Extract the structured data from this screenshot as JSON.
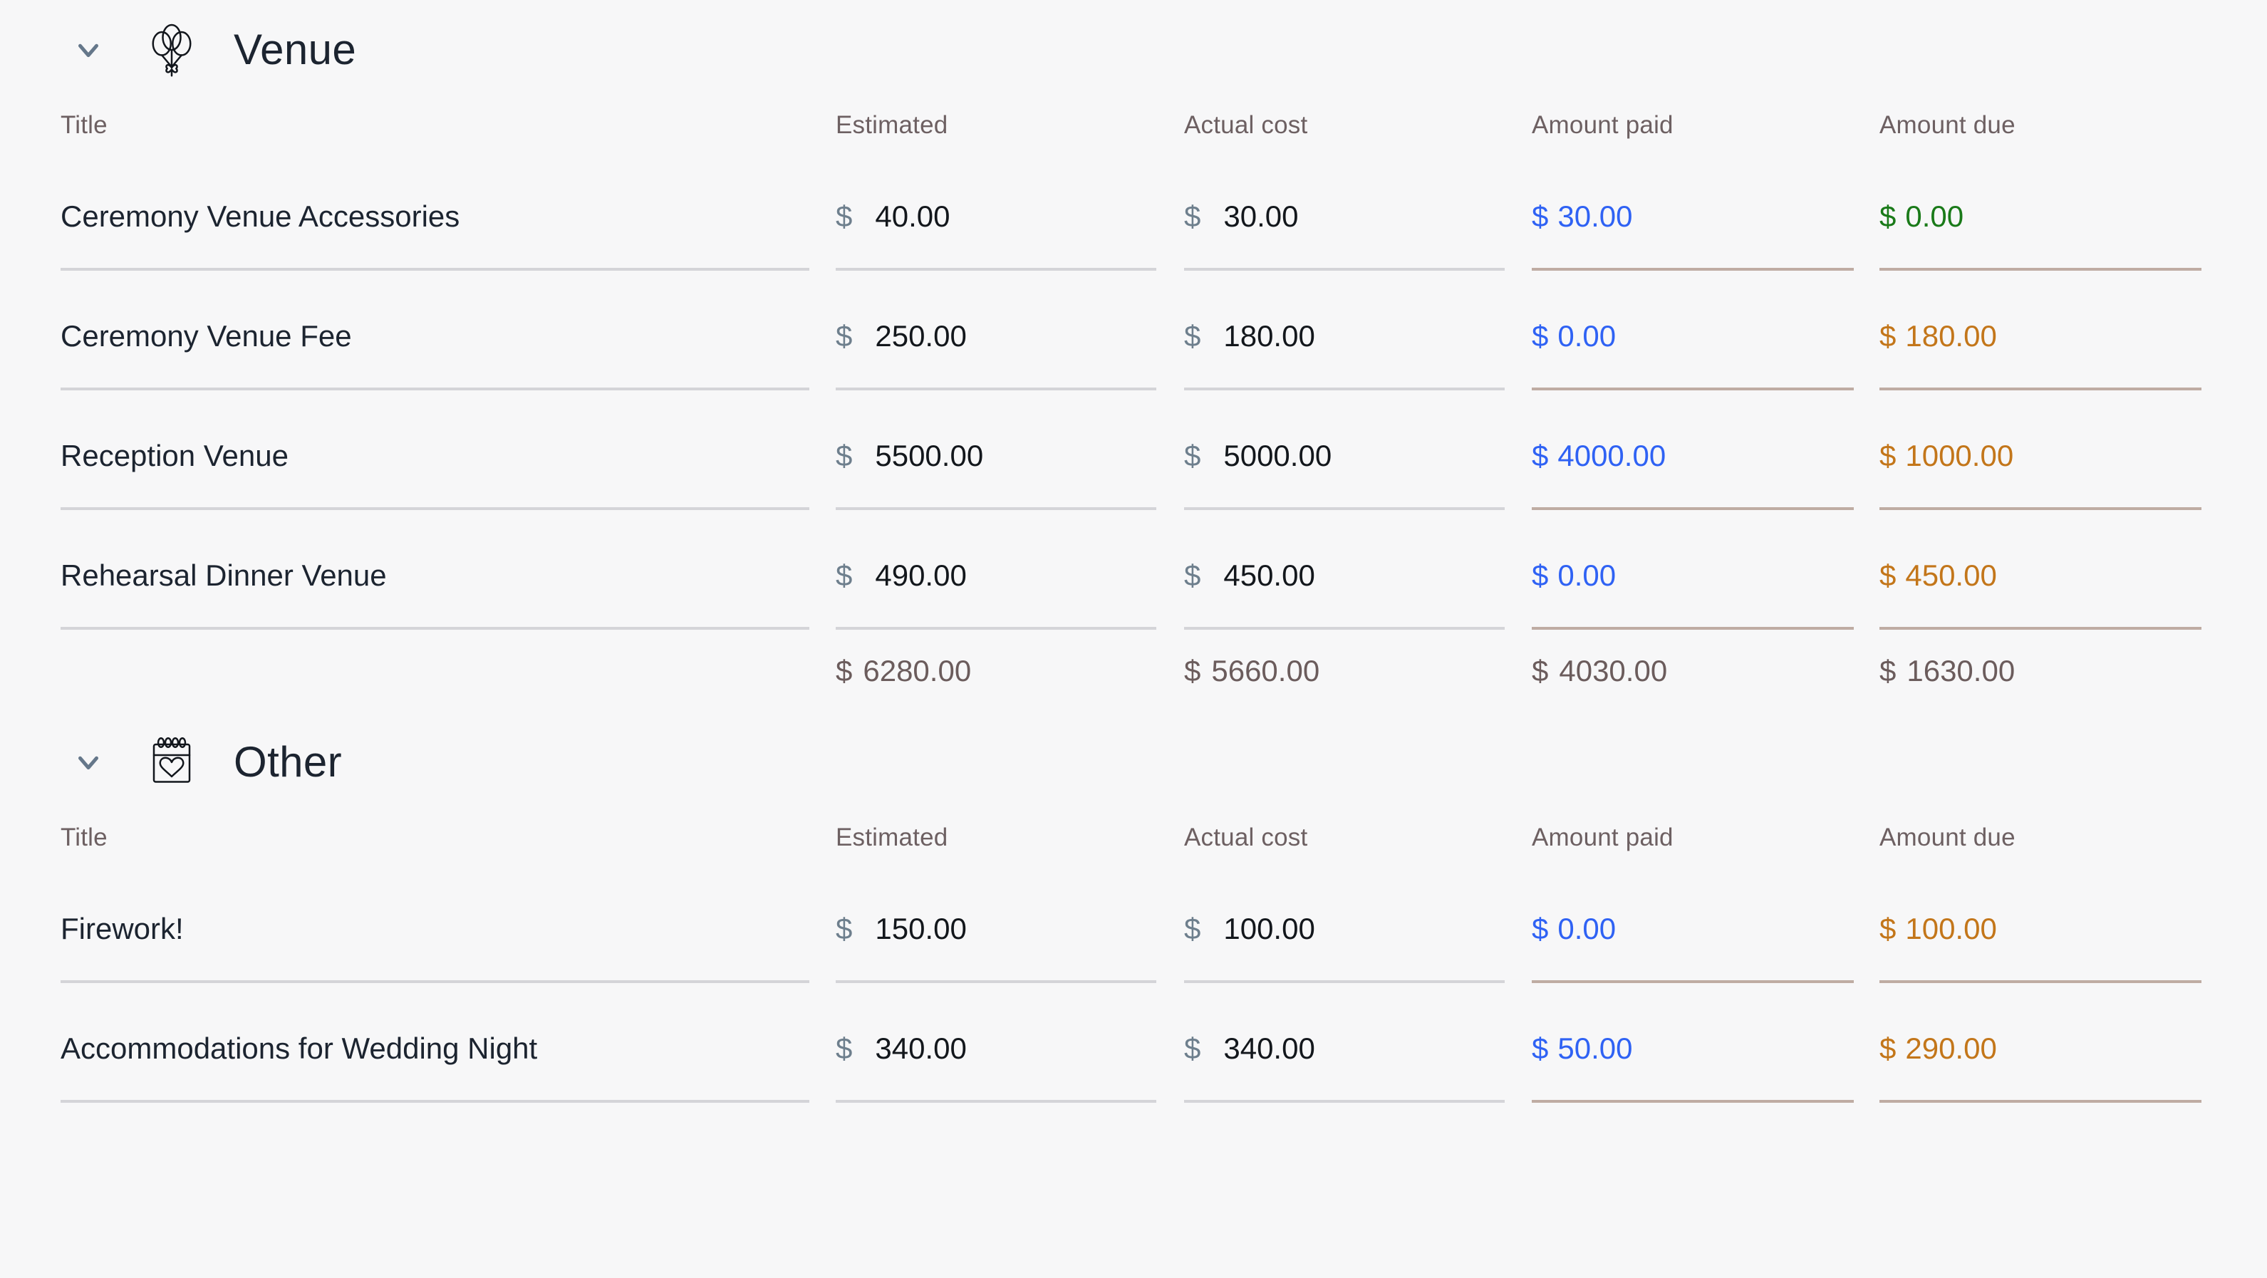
{
  "columns": {
    "title": "Title",
    "estimated": "Estimated",
    "actual": "Actual cost",
    "paid": "Amount paid",
    "due": "Amount due"
  },
  "currency_symbol": "$",
  "colors": {
    "paid": "#2f62f4",
    "due": "#c3761a",
    "due_zero": "#1a7a19",
    "total": "#6b5c5c",
    "symbol_muted": "#6e7f8d",
    "divider": "#d4d4d8",
    "divider_tan": "#bfaca3",
    "background": "#f7f7f8",
    "title_text": "#1c2430",
    "header_text": "#6d6062"
  },
  "sections": [
    {
      "id": "venue",
      "title": "Venue",
      "icon": "balloons-icon",
      "expanded": true,
      "toggle_icon": "chevron-down-icon",
      "rows": [
        {
          "title": "Ceremony Venue Accessories",
          "estimated": "40.00",
          "actual": "30.00",
          "paid": "30.00",
          "due": "0.00",
          "due_state": "zero"
        },
        {
          "title": "Ceremony Venue Fee",
          "estimated": "250.00",
          "actual": "180.00",
          "paid": "0.00",
          "due": "180.00",
          "due_state": "owed"
        },
        {
          "title": "Reception Venue",
          "estimated": "5500.00",
          "actual": "5000.00",
          "paid": "4000.00",
          "due": "1000.00",
          "due_state": "owed"
        },
        {
          "title": "Rehearsal Dinner Venue",
          "estimated": "490.00",
          "actual": "450.00",
          "paid": "0.00",
          "due": "450.00",
          "due_state": "owed"
        }
      ],
      "totals": {
        "estimated": "6280.00",
        "actual": "5660.00",
        "paid": "4030.00",
        "due": "1630.00"
      }
    },
    {
      "id": "other",
      "title": "Other",
      "icon": "calendar-heart-icon",
      "expanded": true,
      "toggle_icon": "chevron-down-icon",
      "rows": [
        {
          "title": "Firework!",
          "estimated": "150.00",
          "actual": "100.00",
          "paid": "0.00",
          "due": "100.00",
          "due_state": "owed"
        },
        {
          "title": "Accommodations for Wedding Night",
          "estimated": "340.00",
          "actual": "340.00",
          "paid": "50.00",
          "due": "290.00",
          "due_state": "owed"
        }
      ],
      "totals": null
    }
  ]
}
